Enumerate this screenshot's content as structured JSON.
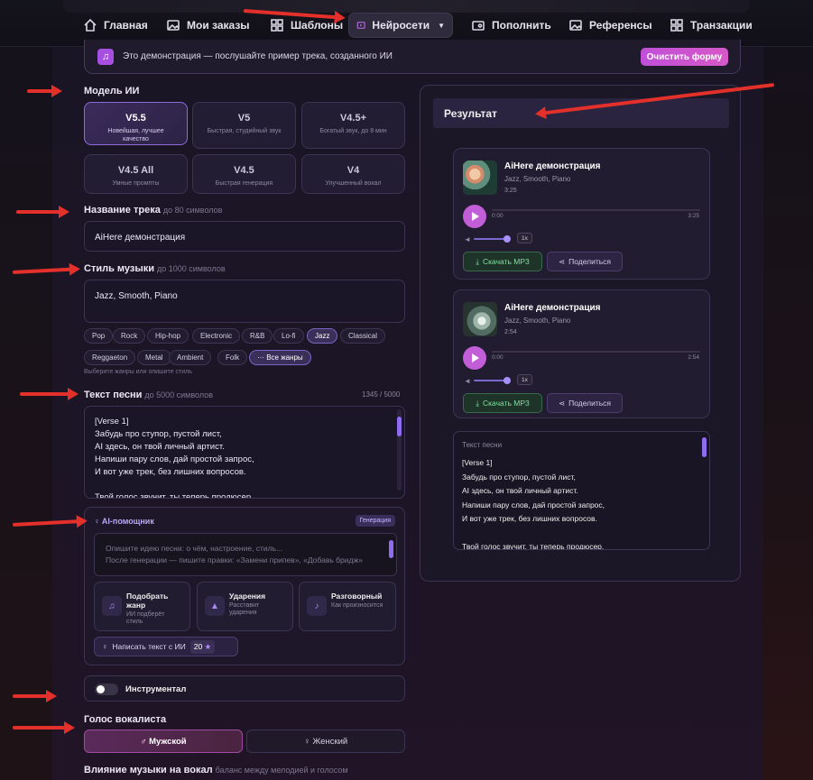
{
  "nav": {
    "items": [
      {
        "label": "Главная",
        "icon": "home-icon"
      },
      {
        "label": "Мои заказы",
        "icon": "image-icon"
      },
      {
        "label": "Шаблоны",
        "icon": "grid-icon"
      },
      {
        "label": "Нейросети",
        "icon": "play-icon",
        "active": true
      },
      {
        "label": "Пополнить",
        "icon": "wallet-icon"
      },
      {
        "label": "Референсы",
        "icon": "image-icon"
      },
      {
        "label": "Транзакции",
        "icon": "grid-icon"
      }
    ]
  },
  "demo": {
    "text": "Это демонстрация — послушайте пример трека, созданного ИИ",
    "clear_label": "Очистить форму"
  },
  "model": {
    "label": "Модель ИИ",
    "options": [
      {
        "title": "V5.5",
        "subtitle": "Новейшая, лучшее качество",
        "selected": true
      },
      {
        "title": "V5",
        "subtitle": "Быстрая, студийный звук"
      },
      {
        "title": "V4.5+",
        "subtitle": "Богатый звук, до 8 мин"
      },
      {
        "title": "V4.5 All",
        "subtitle": "Умные промпты"
      },
      {
        "title": "V4.5",
        "subtitle": "Быстрая генерация"
      },
      {
        "title": "V4",
        "subtitle": "Улучшенный вокал"
      }
    ]
  },
  "track": {
    "label": "Название трека",
    "hint": "до 80 символов",
    "value": "AiHere демонстрация"
  },
  "style": {
    "label": "Стиль музыки",
    "hint": "до 1000 символов",
    "value": "Jazz, Smooth, Piano",
    "genres_row1": [
      "Pop",
      "Rock",
      "Hip-hop",
      "Electronic",
      "R&B",
      "Lo-fi",
      "Jazz",
      "Classical"
    ],
    "genres_row2": [
      "Reggaeton",
      "Metal",
      "Ambient",
      "Folk",
      "··· Все жанры"
    ],
    "selected": "Jazz",
    "helper": "Выберите жанры или опишите стиль"
  },
  "lyrics": {
    "label": "Текст песни",
    "hint": "до 5000 символов",
    "counter": "1345 / 5000",
    "lines": [
      "[Verse 1]",
      "Забудь про ступор, пустой лист,",
      "AI здесь, он твой личный артист.",
      "Напиши пару слов, дай простой запрос,",
      "И вот уже трек, без лишних вопросов.",
      "",
      "Твой голос звучит, ты теперь продюсер,"
    ]
  },
  "ai_helper": {
    "title": "AI-помощник",
    "badge": "Генерация",
    "placeholder": "Опишите идею песни: о чём, настроение, стиль...\nПосле генерации — пишите правки: «Замени припев», «Добавь бридж»",
    "tools": [
      {
        "title": "Подобрать жанр",
        "subtitle": "ИИ подберёт стиль",
        "icon": "music-note-icon"
      },
      {
        "title": "Ударения",
        "subtitle": "Расставит ударения",
        "icon": "accent-icon"
      },
      {
        "title": "Разговорный",
        "subtitle": "Как произносится",
        "icon": "microphone-icon"
      }
    ],
    "write_label": "Написать текст с ИИ",
    "write_cost": "20"
  },
  "instrumental": {
    "label": "Инструментал",
    "on": false
  },
  "vocalist": {
    "label": "Голос вокалиста",
    "male": "♂ Мужской",
    "female": "♀ Женский",
    "selected": "male"
  },
  "influence": {
    "label": "Влияние музыки на вокал",
    "hint": "баланс между мелодией и голосом"
  },
  "result": {
    "title": "Результат",
    "tracks": [
      {
        "title": "AiHere демонстрация",
        "tags": "Jazz, Smooth, Piano",
        "duration": "3:25",
        "current": "0:00",
        "total": "3:25",
        "speed": "1x"
      },
      {
        "title": "AiHere демонстрация",
        "tags": "Jazz, Smooth, Piano",
        "duration": "2:54",
        "current": "0:00",
        "total": "2:54",
        "speed": "1x"
      }
    ],
    "download_label": "Скачать MP3",
    "share_label": "Поделиться",
    "lyrics_heading": "Текст песни",
    "lyrics": "[Verse 1]\nЗабудь про ступор, пустой лист,\nAI здесь, он твой личный артист.\nНапиши пару слов, дай простой запрос,\nИ вот уже трек, без лишних вопросов.\n\nТвой голос звучит, ты теперь продюсер,"
  },
  "colors": {
    "accent": "#a64fe0",
    "annotation_arrow": "#e4302a",
    "selected_border": "#8c6bd8"
  }
}
